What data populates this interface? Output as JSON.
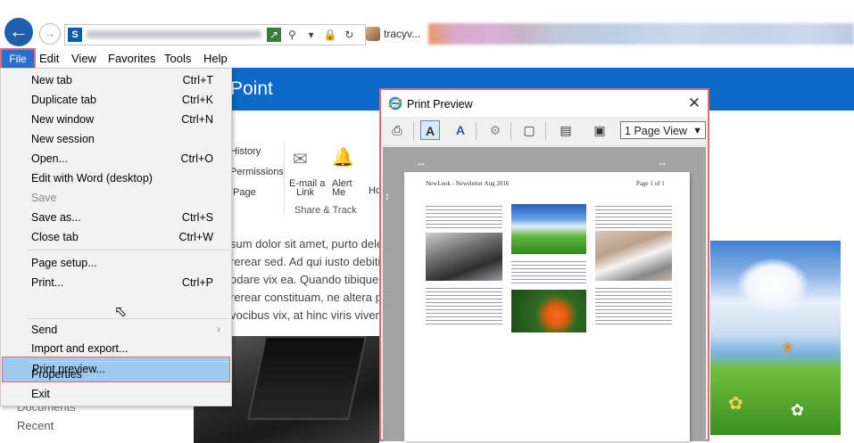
{
  "browser": {
    "tab_title": "tracyv...",
    "sp_icon_letter": "S"
  },
  "menubar": {
    "items": [
      "File",
      "Edit",
      "View",
      "Favorites",
      "Tools",
      "Help"
    ]
  },
  "file_menu": {
    "items": [
      {
        "label": "New tab",
        "shortcut": "Ctrl+T"
      },
      {
        "label": "Duplicate tab",
        "shortcut": "Ctrl+K"
      },
      {
        "label": "New window",
        "shortcut": "Ctrl+N"
      },
      {
        "label": "New session",
        "shortcut": ""
      },
      {
        "label": "Open...",
        "shortcut": "Ctrl+O"
      },
      {
        "label": "Edit with Word (desktop)",
        "shortcut": ""
      },
      {
        "label": "Save",
        "shortcut": ""
      },
      {
        "label": "Save as...",
        "shortcut": "Ctrl+S"
      },
      {
        "label": "Close tab",
        "shortcut": "Ctrl+W"
      },
      {
        "label": "Page setup...",
        "shortcut": ""
      },
      {
        "label": "Print...",
        "shortcut": "Ctrl+P"
      },
      {
        "label": "Print preview...",
        "shortcut": ""
      },
      {
        "label": "Send",
        "shortcut": ""
      },
      {
        "label": "Import and export...",
        "shortcut": ""
      },
      {
        "label": "Properties",
        "shortcut": ""
      },
      {
        "label": "Exit",
        "shortcut": ""
      }
    ]
  },
  "sharepoint": {
    "banner_title": "Point",
    "ribbon": {
      "history": "History",
      "permissions": "Permissions",
      "page": "Page",
      "email_link_1": "E-mail a",
      "email_link_2": "Link",
      "alert_me_1": "Alert",
      "alert_me_2": "Me",
      "group_label": "Share & Track",
      "cut_label": "Ho"
    },
    "body_lines": [
      "sum dolor sit amet, purto deler",
      "rerear sed. Ad qui iusto debitis,",
      "odare vix ea. Quando tibique o",
      "rerear constituam, ne altera prin",
      "vocibus vix, at hinc viris vivendo"
    ],
    "left_nav": {
      "documents": "Documents",
      "recent": "Recent"
    }
  },
  "print_preview": {
    "title": "Print Preview",
    "view_option": "1 Page View",
    "page_header_left": "NewLook - Newsletter Aug 2016",
    "page_header_right": "Page 1 of 1"
  }
}
